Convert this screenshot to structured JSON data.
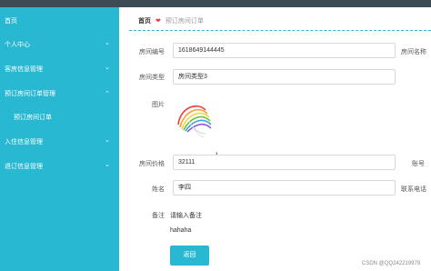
{
  "sidebar": {
    "items": [
      {
        "label": "首页"
      },
      {
        "label": "个人中心"
      },
      {
        "label": "客房信息管理"
      },
      {
        "label": "预订房间订单管理"
      },
      {
        "label": "入住信息管理"
      },
      {
        "label": "退订信息管理"
      }
    ],
    "sub_item": "预订房间订单"
  },
  "breadcrumb": {
    "home": "首页",
    "separator": "❤",
    "current": "预订房间订单"
  },
  "form": {
    "room_no_label": "房间编号",
    "room_no_value": "1618649144445",
    "room_name_label": "房间名称",
    "room_type_label": "房间类型",
    "room_type_value": "房间类型3",
    "image_label": "图片",
    "price_label": "房间价格",
    "price_value": "32111",
    "account_label": "账号",
    "name_label": "姓名",
    "name_value": "李四",
    "phone_label": "联系电话",
    "remark_label": "备注",
    "remark_hint": "请输入备注",
    "remark_value": "hahaha",
    "back_button": "返回"
  },
  "colors": {
    "accent": "#29b8d1",
    "topbar": "#3d4b55",
    "separator": "#e8413c"
  },
  "watermark": "CSDN @QQ242219979"
}
